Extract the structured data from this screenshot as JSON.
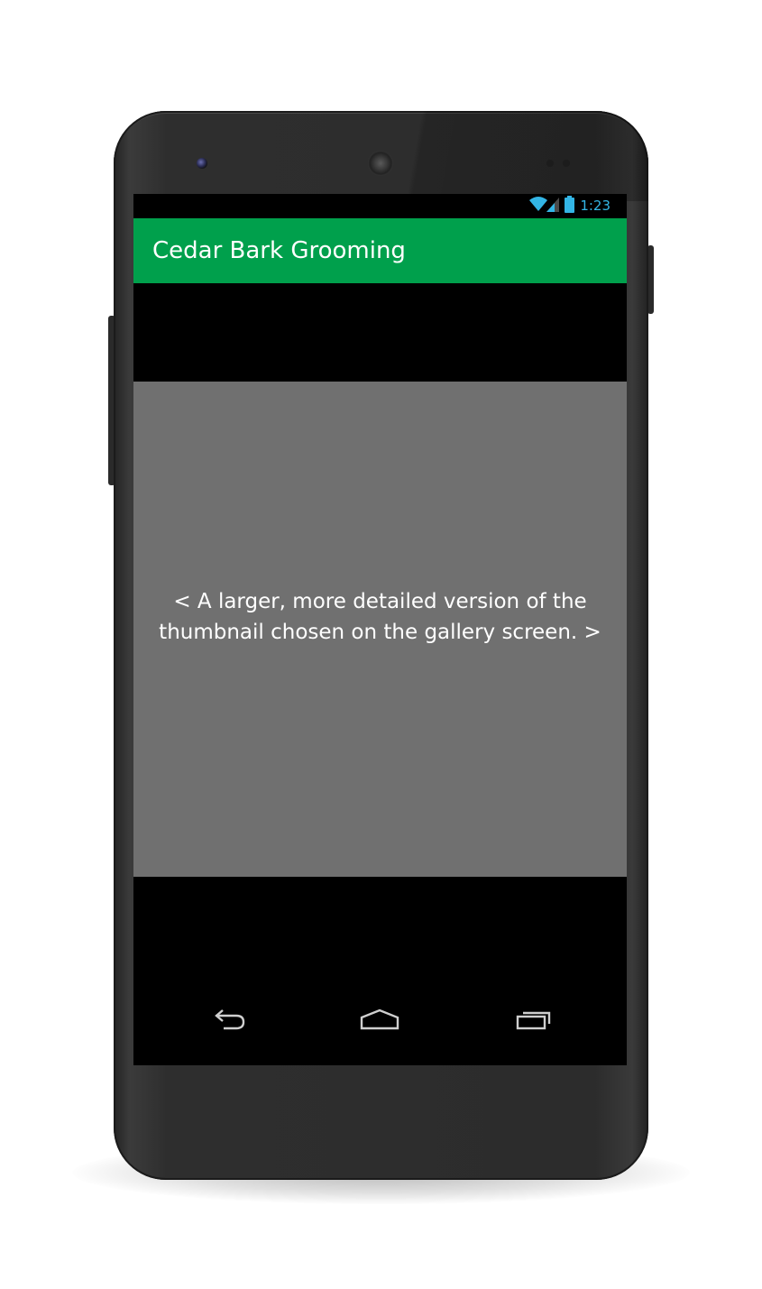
{
  "status_bar": {
    "time": "1:23",
    "icons": [
      "wifi-icon",
      "signal-icon",
      "battery-icon"
    ],
    "icon_color": "#33b5e5"
  },
  "app_bar": {
    "title": "Cedar Bark Grooming",
    "color": "#00a04c"
  },
  "content": {
    "image_placeholder": {
      "line1": "< A larger, more detailed version of the",
      "line2": "thumbnail chosen on the gallery screen. >",
      "background": "#707070"
    }
  },
  "nav_bar": {
    "buttons": [
      "back-icon",
      "home-icon",
      "recents-icon"
    ]
  }
}
